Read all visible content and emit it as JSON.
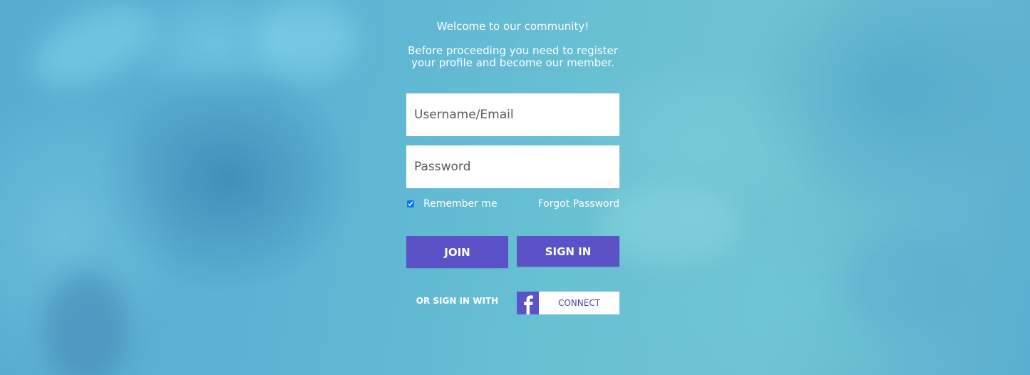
{
  "theme": {
    "accent": "#5b52c8",
    "background": "#5fb6cf",
    "text": "#ffffff"
  },
  "intro": {
    "welcome": "Welcome to our community!",
    "notice": "Before proceeding you need to register\nyour profile and become our member."
  },
  "form": {
    "username_placeholder": "Username/Email",
    "password_placeholder": "Password",
    "remember_label": "Remember me",
    "remember_checked": true,
    "forgot_label": "Forgot Password"
  },
  "actions": {
    "join_label": "JOIN",
    "signin_label": "SIGN IN"
  },
  "social": {
    "or_text": "OR SIGN IN WITH",
    "connect_label": "CONNECT",
    "provider_icon": "facebook-icon"
  }
}
